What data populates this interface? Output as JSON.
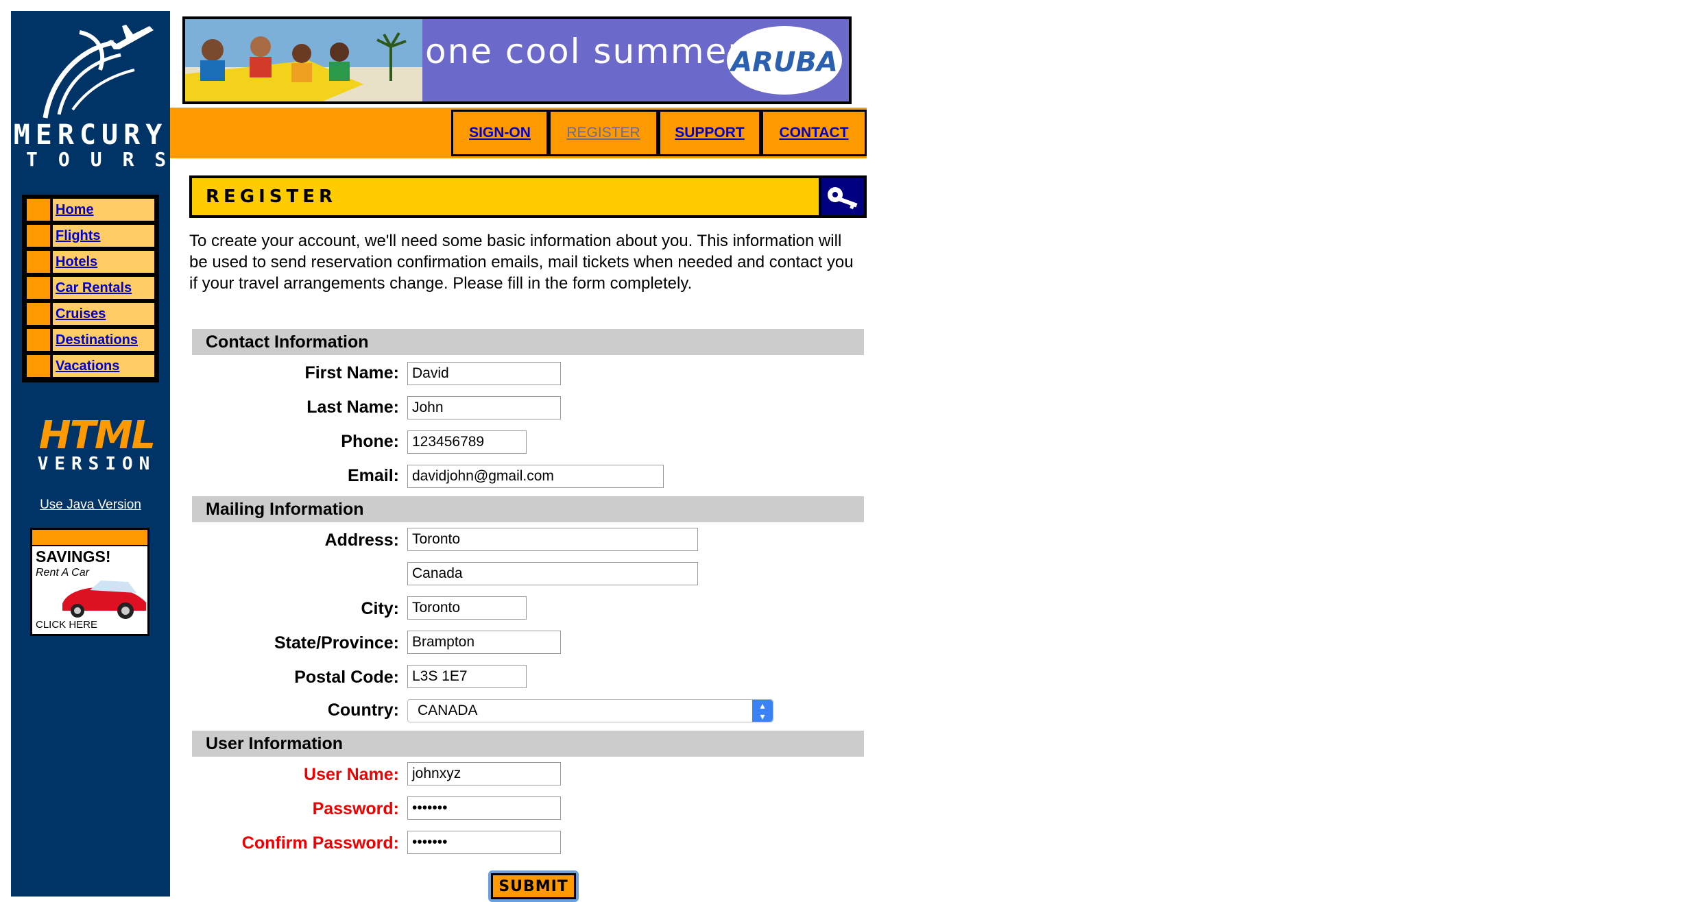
{
  "logo": {
    "line1": "MERCURY",
    "line2": "TOURS"
  },
  "side_nav": [
    "Home",
    "Flights",
    "Hotels",
    "Car Rentals",
    "Cruises",
    "Destinations",
    "Vacations"
  ],
  "html_badge": {
    "big": "HTML",
    "small": "VERSION",
    "java_link": "Use Java Version"
  },
  "savings_ad": {
    "title": "SAVINGS!",
    "subtitle": "Rent A Car",
    "cta": "CLICK HERE"
  },
  "banner": {
    "text": "one cool summer",
    "brand": "ARUBA"
  },
  "top_nav": {
    "signon": "SIGN-ON",
    "register": "REGISTER",
    "support": "SUPPORT",
    "contact": "CONTACT"
  },
  "page": {
    "title": "REGISTER",
    "intro": "To create your account, we'll need some basic information about you. This information will be used to send reservation confirmation emails, mail tickets when needed and contact you if your travel arrangements change. Please fill in the form completely."
  },
  "sections": {
    "contact": "Contact Information",
    "mailing": "Mailing Information",
    "user": "User Information"
  },
  "labels": {
    "first_name": "First Name:",
    "last_name": "Last Name:",
    "phone": "Phone:",
    "email": "Email:",
    "address": "Address:",
    "city": "City:",
    "state": "State/Province:",
    "postal": "Postal Code:",
    "country": "Country:",
    "user_name": "User Name:",
    "password": "Password:",
    "confirm_password": "Confirm Password:"
  },
  "values": {
    "first_name": "David",
    "last_name": "John",
    "phone": "123456789",
    "email": "davidjohn@gmail.com",
    "address1": "Toronto",
    "address2": "Canada",
    "city": "Toronto",
    "state": "Brampton",
    "postal": "L3S 1E7",
    "country": "CANADA",
    "user_name": "johnxyz",
    "password": "•••••••",
    "confirm_password": "•••••••"
  },
  "submit_label": "SUBMIT",
  "colors": {
    "sidebar": "#003366",
    "accent": "#ff9900",
    "header_yellow": "#ffcc00",
    "required": "#ee0000"
  }
}
